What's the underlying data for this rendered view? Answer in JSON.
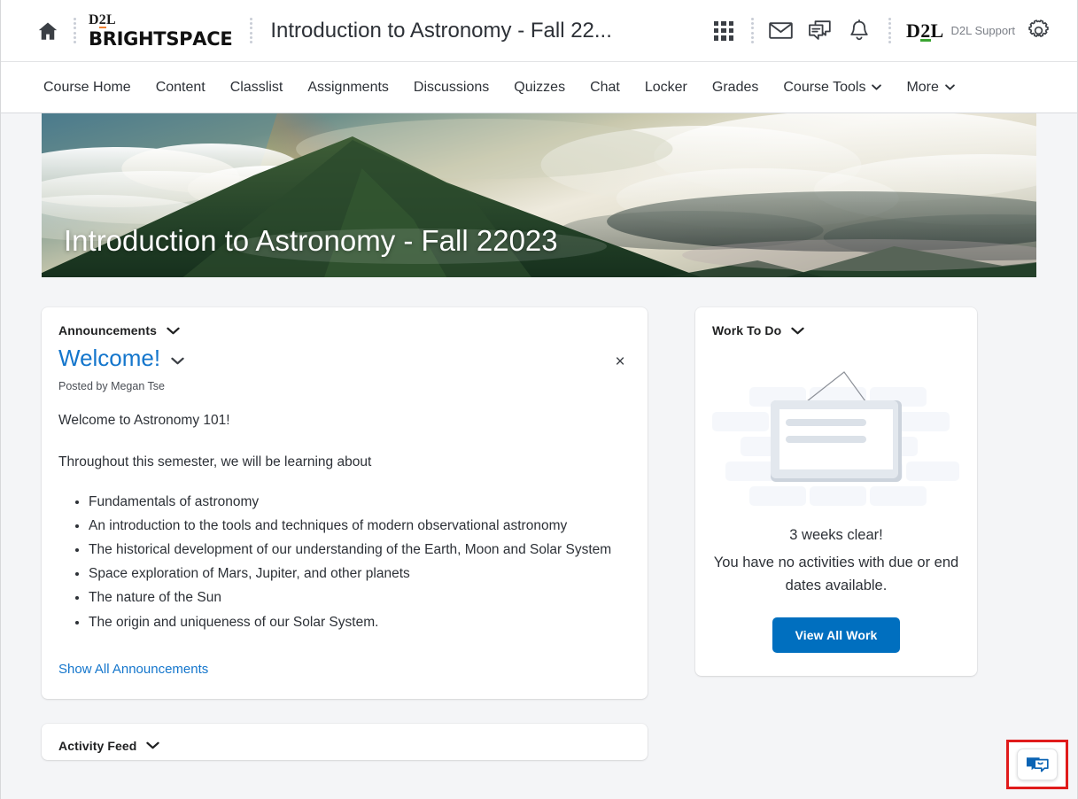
{
  "header": {
    "home_icon": "home-icon",
    "brand_top": "D2L",
    "brand_bottom": "BRIGHTSPACE",
    "course_title": "Introduction to Astronomy - Fall 22...",
    "waffle_icon": "apps-grid-icon",
    "email_icon": "envelope-icon",
    "messages_icon": "chat-bubble-icon",
    "alerts_icon": "bell-icon",
    "d2l_mark": "D2L",
    "support_label": "D2L Support",
    "settings_icon": "gear-icon"
  },
  "nav": {
    "items": [
      {
        "label": "Course Home",
        "has_chevron": false
      },
      {
        "label": "Content",
        "has_chevron": false
      },
      {
        "label": "Classlist",
        "has_chevron": false
      },
      {
        "label": "Assignments",
        "has_chevron": false
      },
      {
        "label": "Discussions",
        "has_chevron": false
      },
      {
        "label": "Quizzes",
        "has_chevron": false
      },
      {
        "label": "Chat",
        "has_chevron": false
      },
      {
        "label": "Locker",
        "has_chevron": false
      },
      {
        "label": "Grades",
        "has_chevron": false
      },
      {
        "label": "Course Tools",
        "has_chevron": true
      },
      {
        "label": "More",
        "has_chevron": true
      }
    ]
  },
  "banner": {
    "title": "Introduction to Astronomy - Fall 22023",
    "image_description": "mountain-with-clouds-and-rainbow-photo"
  },
  "announcements": {
    "widget_title": "Announcements",
    "collapse_icon": "chevron-down-icon",
    "post_title": "Welcome!",
    "post_menu_icon": "chevron-down-icon",
    "dismiss_icon": "close-icon",
    "dismiss_glyph": "×",
    "posted_by": "Posted by Megan Tse",
    "paragraph_1": "Welcome to Astronomy 101!",
    "paragraph_2": "Throughout this semester, we will be learning about",
    "bullets": [
      "Fundamentals of astronomy",
      "An introduction to the tools and techniques of modern observational astronomy",
      "The historical development of our understanding of the Earth, Moon and Solar System",
      "Space exploration of Mars, Jupiter, and other planets",
      "The nature of the Sun",
      "The origin and uniqueness of our Solar System."
    ],
    "show_all_label": "Show All Announcements",
    "link_color": "#1476cc"
  },
  "activity_feed": {
    "widget_title": "Activity Feed",
    "collapse_icon": "chevron-down-icon"
  },
  "work_to_do": {
    "widget_title": "Work To Do",
    "collapse_icon": "chevron-down-icon",
    "illustration": "hanging-checklist-board-illustration",
    "headline": "3 weeks clear!",
    "message": "You have no activities with due or end dates available.",
    "button_label": "View All Work",
    "button_color": "#006fbf",
    "check_color": "#4aa84f"
  },
  "chat_widget": {
    "icon": "chat-bubbles-icon",
    "highlight_color": "#e01b1b",
    "icon_color": "#0a63b4"
  }
}
